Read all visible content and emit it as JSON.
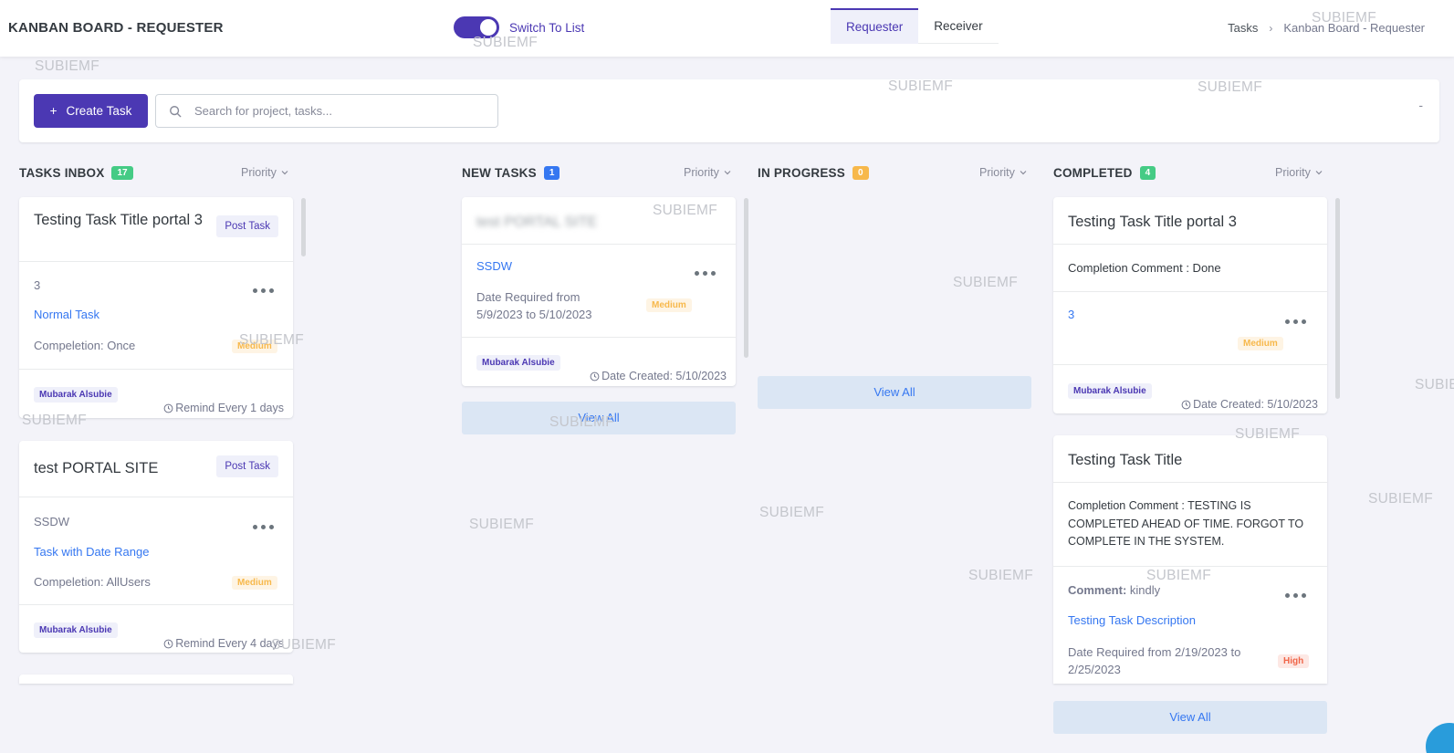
{
  "header": {
    "title": "KANBAN BOARD - REQUESTER",
    "toggle_label": "Switch To List",
    "tabs": [
      {
        "label": "Requester",
        "active": true
      },
      {
        "label": "Receiver",
        "active": false
      }
    ],
    "breadcrumb": [
      "Tasks",
      "Kanban Board - Requester"
    ]
  },
  "toolbar": {
    "create_label": "Create Task",
    "create_icon": "+",
    "search_placeholder": "Search for project, tasks...",
    "right_text": "-"
  },
  "watermark": "SUBIEMF",
  "columns": {
    "inbox": {
      "title": "TASKS INBOX",
      "count": "17",
      "sort_label": "Priority",
      "color": "#45cb85"
    },
    "new": {
      "title": "NEW TASKS",
      "count": "1",
      "sort_label": "Priority",
      "color": "#3577f1"
    },
    "progress": {
      "title": "IN PROGRESS",
      "count": "0",
      "sort_label": "Priority",
      "color": "#f7b84b"
    },
    "completed": {
      "title": "COMPLETED",
      "count": "4",
      "sort_label": "Priority",
      "color": "#45cb85"
    }
  },
  "inbox_cards": [
    {
      "title": "Testing Task Title portal 3",
      "badge": "Post Task",
      "ref": "3",
      "type": "Normal Task",
      "completion": "Compeletion: Once",
      "priority": "Medium",
      "user": "Mubarak Alsubie",
      "footer": "Remind Every 1 days"
    },
    {
      "title": "test PORTAL SITE",
      "badge": "Post Task",
      "ref": "SSDW",
      "type": "Task with Date Range",
      "completion": "Compeletion: AllUsers",
      "priority": "Medium",
      "user": "Mubarak Alsubie",
      "footer": "Remind Every 4 days"
    }
  ],
  "new_cards": [
    {
      "title": "test PORTAL SITE",
      "link": "SSDW",
      "date_required": "Date Required from 5/9/2023 to 5/10/2023",
      "priority": "Medium",
      "user": "Mubarak Alsubie",
      "footer": "Date Created: 5/10/2023"
    }
  ],
  "completed_cards": [
    {
      "title": "Testing Task Title portal 3",
      "comment": "Completion Comment : Done",
      "link": "3",
      "priority": "Medium",
      "user": "Mubarak Alsubie",
      "footer": "Date Created: 5/10/2023"
    },
    {
      "title": "Testing Task Title",
      "comment": "Completion Comment : TESTING IS COMPLETED AHEAD OF TIME. FORGOT TO COMPLETE IN THE SYSTEM.",
      "comment_label": "Comment:",
      "comment_value": "kindly",
      "link": "Testing Task Description",
      "date_required": "Date Required from 2/19/2023 to 2/25/2023",
      "priority": "High"
    }
  ],
  "view_all_label": "View All"
}
